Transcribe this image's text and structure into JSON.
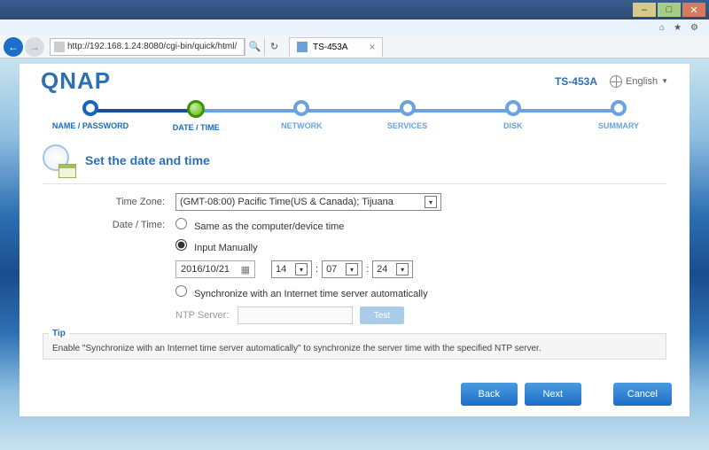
{
  "window": {
    "url": "http://192.168.1.24:8080/cgi-bin/quick/html/",
    "tab_title": "TS-453A"
  },
  "header": {
    "brand": "QNAP",
    "model": "TS-453A",
    "language": "English"
  },
  "stepper": {
    "steps": [
      {
        "label": "NAME / PASSWORD"
      },
      {
        "label": "DATE / TIME"
      },
      {
        "label": "NETWORK"
      },
      {
        "label": "SERVICES"
      },
      {
        "label": "DISK"
      },
      {
        "label": "SUMMARY"
      }
    ]
  },
  "panel": {
    "title": "Set the date and time",
    "timezone_label": "Time Zone:",
    "timezone_value": "(GMT-08:00) Pacific Time(US & Canada); Tijuana",
    "datetime_label": "Date / Time:",
    "opt_same": "Same as the computer/device time",
    "opt_manual": "Input Manually",
    "date_value": "2016/10/21",
    "hour": "14",
    "minute": "07",
    "second": "24",
    "colon": ":",
    "opt_ntp": "Synchronize with an Internet time server automatically",
    "ntp_label": "NTP Server:",
    "test_btn": "Test",
    "tip_label": "Tip",
    "tip_text": "Enable \"Synchronize with an Internet time server automatically\" to synchronize the server time with the specified NTP server."
  },
  "buttons": {
    "back": "Back",
    "next": "Next",
    "cancel": "Cancel"
  }
}
